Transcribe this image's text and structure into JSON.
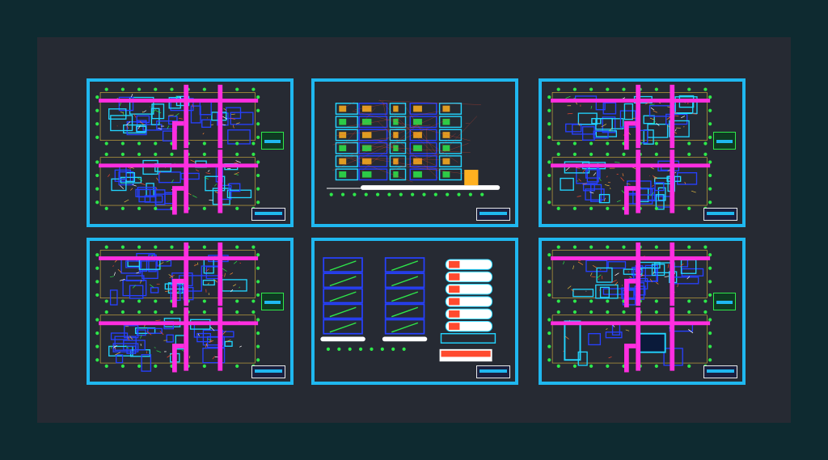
{
  "viewport": {
    "background": "#0e2a30",
    "canvas_background": "#262a33"
  },
  "colors": {
    "sheet_border": "#1fb8f0",
    "pipe": "#ff2ee0",
    "wall": "#2640ff",
    "grid_marker": "#2ee84a",
    "annotation": "#e8c040",
    "hatch": "#ff4a2e"
  },
  "sheets": [
    {
      "id": "sheet-1",
      "kind": "floor-plan"
    },
    {
      "id": "sheet-2",
      "kind": "elevation"
    },
    {
      "id": "sheet-3",
      "kind": "floor-plan"
    },
    {
      "id": "sheet-4",
      "kind": "floor-plan"
    },
    {
      "id": "sheet-5",
      "kind": "sections"
    },
    {
      "id": "sheet-6",
      "kind": "floor-plan"
    }
  ]
}
